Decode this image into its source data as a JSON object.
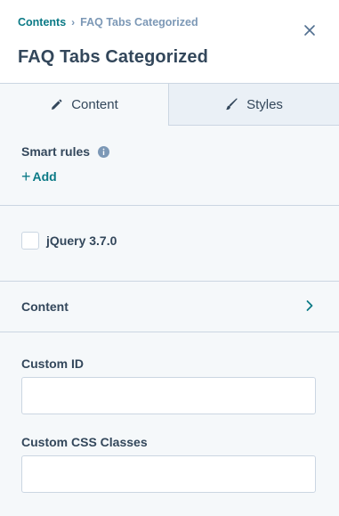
{
  "breadcrumb": {
    "parent": "Contents",
    "separator": "›",
    "current": "FAQ Tabs Categorized"
  },
  "header": {
    "title": "FAQ Tabs Categorized",
    "close_icon": "close-icon"
  },
  "tabs": [
    {
      "label": "Content",
      "icon": "pencil-icon",
      "active": true
    },
    {
      "label": "Styles",
      "icon": "brush-icon",
      "active": false
    }
  ],
  "smart_rules": {
    "label": "Smart rules",
    "info_icon": "info-icon",
    "add_plus": "+",
    "add_label": "Add"
  },
  "jquery": {
    "label": "jQuery 3.7.0",
    "checked": false
  },
  "content_section": {
    "label": "Content",
    "chevron_icon": "chevron-right-icon"
  },
  "custom_id": {
    "label": "Custom ID",
    "value": "",
    "placeholder": ""
  },
  "custom_css": {
    "label": "Custom CSS Classes",
    "value": "",
    "placeholder": ""
  },
  "colors": {
    "teal_link": "#0b7a86",
    "text": "#33475b",
    "muted": "#7c98b6",
    "panel_bg": "#f5f8fa",
    "inactive_tab_bg": "#eaf0f6",
    "border": "#cbd6e2"
  }
}
